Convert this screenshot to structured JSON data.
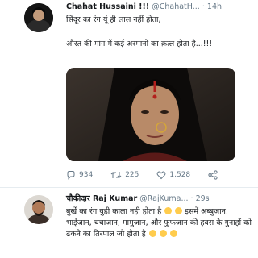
{
  "tweets": [
    {
      "display_name": "Chahat Hussaini !!!",
      "handle": "@ChahatH...",
      "separator": "·",
      "time": "14h",
      "text_line1": "सिंदूर का रंग यूं ही लाल नहीं होता,",
      "text_line2": "औरत की मांग में कई अरमानों का क़त्ल होता है...!!!",
      "reply_count": "934",
      "retweet_count": "225",
      "like_count": "1,528",
      "icons": [
        "reply-icon",
        "retweet-icon",
        "like-icon",
        "share-icon"
      ]
    },
    {
      "display_name": "चौकीदार Raj Kumar",
      "handle": "@RajKuma...",
      "separator": "·",
      "time": "29s",
      "text_part1": "बुर्खे का रंग युही काला नही होता है",
      "text_part2": "इसमें अब्बुजान, भाईजान, चचाजान, मामुजान, और फुफजान की हवस के गुनाहों को ढकने का तिरपाल जो होता है",
      "emojis": [
        "thinking-face",
        "smiling-face",
        "laughing-face",
        "laughing-face",
        "laughing-face"
      ]
    }
  ],
  "colors": {
    "text_primary": "#14171a",
    "text_secondary": "#657786",
    "divider": "#e6ecf0",
    "emoji": "#ffcc4d"
  }
}
